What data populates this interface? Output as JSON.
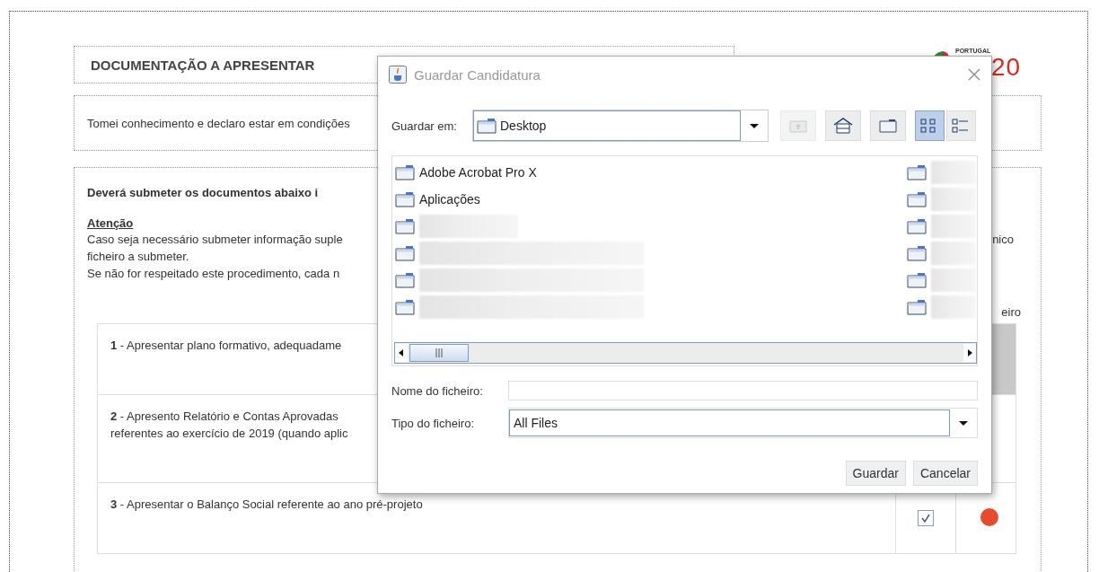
{
  "page": {
    "title": "DOCUMENTAÇÃO A APRESENTAR",
    "logo": {
      "caption": "PORTUGAL",
      "mark": "20"
    },
    "declaration": {
      "text": "Tomei conhecimento e declaro estar em condições"
    },
    "instructions": {
      "heading": "Deverá submeter os documentos abaixo i",
      "attention": "Atenção",
      "lines": [
        {
          "left": "Caso seja necessário submeter informação suple",
          "right": "nico"
        },
        {
          "left": "ficheiro a submeter."
        },
        {
          "left": "Se não for respeitado este procedimento, cada n"
        }
      ]
    },
    "table": {
      "column_3_heading": "eiro",
      "rows": [
        {
          "number": "1",
          "lines": [
            "- Apresentar plano formativo, adequadame"
          ],
          "selected": true
        },
        {
          "number": "2",
          "lines": [
            "- Apresento Relatório e Contas Aprovadas",
            "referentes ao exercício de 2019 (quando aplic"
          ],
          "selected": false
        },
        {
          "number": "3",
          "lines": [
            "- Apresentar o Balanço Social referente ao ano pré-projeto"
          ],
          "selected": false,
          "checked": true,
          "color": "#e84a2e"
        }
      ]
    }
  },
  "dialog": {
    "title": "Guardar Candidatura",
    "save_in": {
      "label": "Guardar em:",
      "value": "Desktop"
    },
    "toolbar": [
      {
        "kind": "up",
        "disabled": true,
        "selected": false
      },
      {
        "kind": "home",
        "disabled": false,
        "selected": false
      },
      {
        "kind": "new-folder",
        "disabled": false,
        "selected": false
      },
      {
        "kind": "list",
        "disabled": false,
        "selected": true
      },
      {
        "kind": "details",
        "disabled": false,
        "selected": false
      }
    ],
    "files": [
      {
        "kind": "folder",
        "name": "Adobe Acrobat Pro X"
      },
      {
        "kind": "folder",
        "name": "Aplicações"
      },
      {
        "kind": "redacted"
      },
      {
        "kind": "redacted"
      },
      {
        "kind": "redacted"
      },
      {
        "kind": "redacted"
      },
      {
        "kind": "redacted"
      },
      {
        "kind": "redacted"
      },
      {
        "kind": "redacted"
      },
      {
        "kind": "redacted"
      },
      {
        "kind": "redacted"
      },
      {
        "kind": "redacted"
      }
    ],
    "file_name": {
      "label": "Nome do ficheiro:"
    },
    "file_type": {
      "label": "Tipo do ficheiro:",
      "value": "All Files"
    },
    "buttons": [
      "Guardar",
      "Cancelar"
    ]
  }
}
